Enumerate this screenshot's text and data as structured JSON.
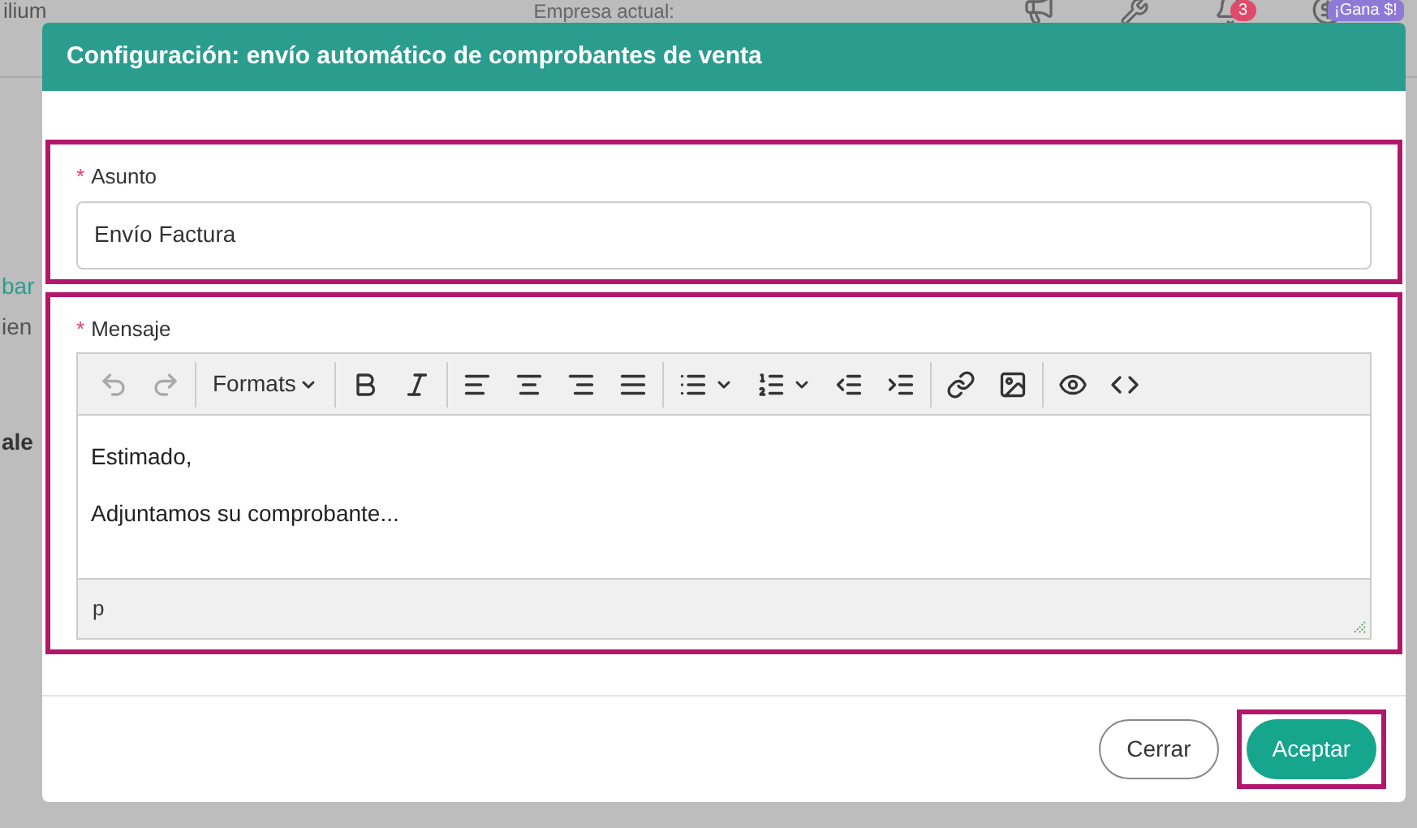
{
  "background": {
    "top_left": "ilium",
    "company_label": "Empresa actual:",
    "notification_count": "3",
    "promo_badge": "¡Gana $!",
    "side_texts": [
      {
        "text": "bar",
        "kind": "link"
      },
      {
        "text": "ien",
        "kind": "plain"
      },
      {
        "text": "ale",
        "kind": "bold"
      }
    ]
  },
  "dialog": {
    "title": "Configuración: envío automático de comprobantes de venta",
    "subject": {
      "label": "Asunto",
      "marker": "*",
      "value": "Envío Factura",
      "highlighted": true
    },
    "message": {
      "label": "Mensaje",
      "marker": "*",
      "highlighted": true,
      "toolbar": [
        [
          {
            "kind": "undo",
            "disabled": true
          },
          {
            "kind": "redo",
            "disabled": true
          }
        ],
        [
          {
            "kind": "formats",
            "label": "Formats",
            "disabled": false
          }
        ],
        [
          {
            "kind": "bold",
            "disabled": false
          },
          {
            "kind": "italic",
            "disabled": false
          }
        ],
        [
          {
            "kind": "align-left",
            "disabled": false
          },
          {
            "kind": "align-center",
            "disabled": false
          },
          {
            "kind": "align-right",
            "disabled": false
          },
          {
            "kind": "align-justify",
            "disabled": false
          }
        ],
        [
          {
            "kind": "bullet-list",
            "disabled": false
          },
          {
            "kind": "numbered-list",
            "disabled": false
          },
          {
            "kind": "outdent",
            "disabled": false
          },
          {
            "kind": "indent",
            "disabled": false
          }
        ],
        [
          {
            "kind": "link",
            "disabled": false
          },
          {
            "kind": "image",
            "disabled": false
          }
        ],
        [
          {
            "kind": "preview",
            "disabled": false
          },
          {
            "kind": "code",
            "disabled": false
          }
        ]
      ],
      "paragraphs": [
        "Estimado,",
        "Adjuntamos su comprobante..."
      ],
      "status_path": "p"
    },
    "buttons": [
      {
        "label": "Cerrar",
        "kind": "secondary",
        "highlighted": false
      },
      {
        "label": "Aceptar",
        "kind": "primary",
        "highlighted": true
      }
    ]
  }
}
